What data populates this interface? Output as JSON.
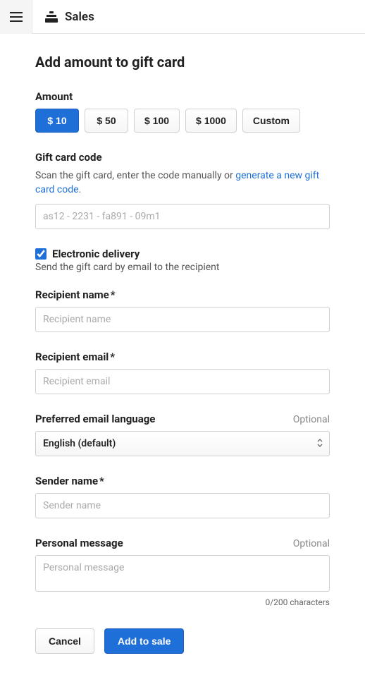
{
  "header": {
    "title": "Sales"
  },
  "page": {
    "title": "Add amount to gift card",
    "amount": {
      "label": "Amount",
      "options": [
        "$ 10",
        "$ 50",
        "$ 100",
        "$ 1000",
        "Custom"
      ],
      "selected_index": 0
    },
    "code": {
      "label": "Gift card code",
      "helper_pre": "Scan the gift card, enter the code manually or ",
      "helper_link": "generate a new gift card code",
      "helper_post": ".",
      "placeholder": "as12 - 2231 - fa891 - 09m1",
      "value": ""
    },
    "electronic": {
      "label": "Electronic delivery",
      "helper": "Send the gift card by email to the recipient",
      "checked": true
    },
    "recipient_name": {
      "label": "Recipient name",
      "required": "*",
      "placeholder": "Recipient name",
      "value": ""
    },
    "recipient_email": {
      "label": "Recipient email",
      "required": "*",
      "placeholder": "Recipient email",
      "value": ""
    },
    "language": {
      "label": "Preferred email language",
      "optional": "Optional",
      "selected": "English (default)"
    },
    "sender_name": {
      "label": "Sender name",
      "required": "*",
      "placeholder": "Sender name",
      "value": ""
    },
    "message": {
      "label": "Personal message",
      "optional": "Optional",
      "placeholder": "Personal message",
      "value": "",
      "counter": "0/200 characters"
    },
    "actions": {
      "cancel": "Cancel",
      "submit": "Add to sale"
    }
  }
}
